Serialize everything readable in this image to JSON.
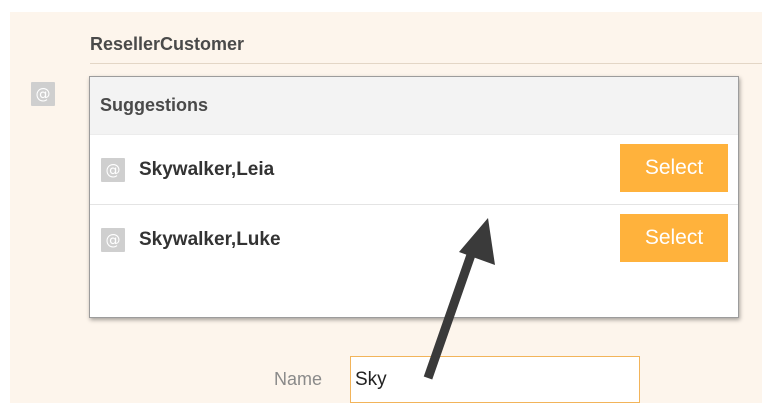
{
  "section": {
    "title": "ResellerCustomer"
  },
  "side_icon": {
    "glyph": "@",
    "icon": "at-icon"
  },
  "suggestions": {
    "header": "Suggestions",
    "items": [
      {
        "icon_glyph": "@",
        "label": "Skywalker,Leia",
        "button": "Select"
      },
      {
        "icon_glyph": "@",
        "label": "Skywalker,Luke",
        "button": "Select"
      }
    ]
  },
  "name_field": {
    "label": "Name",
    "value": "Sky"
  },
  "colors": {
    "accent": "#ffb23c",
    "panel_bg": "#fdf5ec",
    "arrow": "#3a3a3a"
  }
}
